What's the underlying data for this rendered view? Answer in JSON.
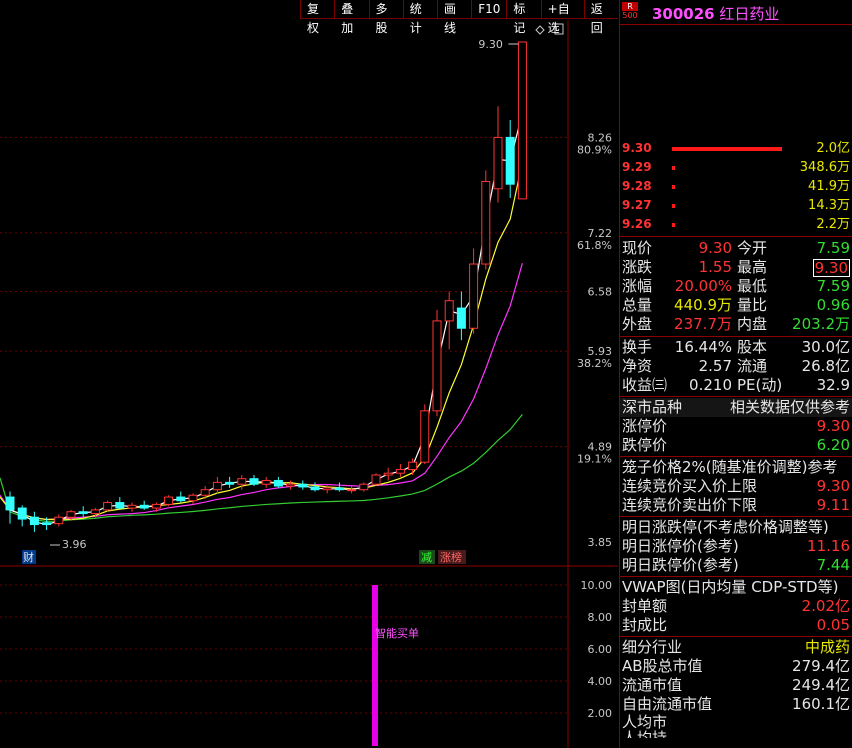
{
  "toolbar": [
    "复权",
    "叠加",
    "多股",
    "统计",
    "画线",
    "F10",
    "标记",
    "+自选",
    "返回"
  ],
  "header": {
    "badge_r": "R",
    "badge_num": "500",
    "code": "300026",
    "name": "红日药业"
  },
  "order_book": [
    {
      "price": "9.30",
      "vol": "2.0亿",
      "frac": 1.0
    },
    {
      "price": "9.29",
      "vol": "348.6万",
      "frac": 0.02
    },
    {
      "price": "9.28",
      "vol": "41.9万",
      "frac": 0.01
    },
    {
      "price": "9.27",
      "vol": "14.3万",
      "frac": 0.01
    },
    {
      "price": "9.26",
      "vol": "2.2万",
      "frac": 0.01
    }
  ],
  "quote": [
    {
      "l1": "现价",
      "v1": "9.30",
      "c1": "red",
      "l2": "今开",
      "v2": "7.59",
      "c2": "grn"
    },
    {
      "l1": "涨跌",
      "v1": "1.55",
      "c1": "red",
      "l2": "最高",
      "v2": "9.30",
      "c2": "red",
      "boxed": true
    },
    {
      "l1": "涨幅",
      "v1": "20.00%",
      "c1": "red",
      "l2": "最低",
      "v2": "7.59",
      "c2": "grn"
    },
    {
      "l1": "总量",
      "v1": "440.9万",
      "c1": "yel",
      "l2": "量比",
      "v2": "0.96",
      "c2": "grn"
    },
    {
      "l1": "外盘",
      "v1": "237.7万",
      "c1": "red",
      "l2": "内盘",
      "v2": "203.2万",
      "c2": "grn"
    }
  ],
  "fund": [
    {
      "l1": "换手",
      "v1": "16.44%",
      "l2": "股本",
      "v2": "30.0亿"
    },
    {
      "l1": "净资",
      "v1": "2.57",
      "l2": "流通",
      "v2": "26.8亿"
    },
    {
      "l1": "收益㈢",
      "v1": "0.210",
      "l2": "PE(动)",
      "v2": "32.9"
    }
  ],
  "limits": {
    "board": "深市品种",
    "note": "相关数据仅供参考",
    "up_label": "涨停价",
    "up": "9.30",
    "down_label": "跌停价",
    "down": "6.20"
  },
  "cage": {
    "title": "笼子价格2%(随基准价调整)参考",
    "buy_label": "连续竞价买入价上限",
    "buy": "9.30",
    "sell_label": "连续竞价卖出价下限",
    "sell": "9.11"
  },
  "tomorrow": {
    "title": "明日涨跌停(不考虑价格调整等)",
    "up_label": "明日涨停价(参考)",
    "up": "11.16",
    "down_label": "明日跌停价(参考)",
    "down": "7.44"
  },
  "vwap": {
    "title": "VWAP图(日内均量 CDP-STD等)",
    "seal_label": "封单额",
    "seal": "2.02亿",
    "ratio_label": "封成比",
    "ratio": "0.05"
  },
  "industry": {
    "label": "细分行业",
    "value": "中成药",
    "ab_label": "AB股总市值",
    "ab": "279.4亿",
    "float_label": "流通市值",
    "float": "249.4亿",
    "free_label": "自由流通市值",
    "free": "160.1亿",
    "per1": "人均市",
    "per2": "人均持"
  },
  "chart_text": {
    "high_label": "9.30",
    "low_label": "3.96",
    "cai": "财",
    "jian": "减",
    "zhang": "涨榜",
    "indicator_label": "智能买单",
    "price_ticks": [
      "8.26",
      "7.22",
      "6.58",
      "5.93",
      "4.89",
      "3.85"
    ],
    "pct_ticks": [
      "80.9%",
      "61.8%",
      "38.2%",
      "19.1%"
    ],
    "ind_ticks": [
      "10.00",
      "8.00",
      "6.00",
      "4.00",
      "2.00"
    ]
  },
  "chart_data": {
    "type": "candlestick",
    "ylim": [
      3.85,
      9.3
    ],
    "candles": [
      [
        4.34,
        4.4,
        4.05,
        4.2
      ],
      [
        4.22,
        4.25,
        4.02,
        4.1
      ],
      [
        4.12,
        4.18,
        3.96,
        4.04
      ],
      [
        4.06,
        4.12,
        3.98,
        4.04
      ],
      [
        4.05,
        4.15,
        4.02,
        4.12
      ],
      [
        4.12,
        4.2,
        4.08,
        4.18
      ],
      [
        4.18,
        4.24,
        4.12,
        4.16
      ],
      [
        4.16,
        4.22,
        4.1,
        4.2
      ],
      [
        4.2,
        4.3,
        4.18,
        4.28
      ],
      [
        4.28,
        4.34,
        4.2,
        4.22
      ],
      [
        4.22,
        4.28,
        4.18,
        4.25
      ],
      [
        4.25,
        4.3,
        4.2,
        4.22
      ],
      [
        4.22,
        4.28,
        4.18,
        4.26
      ],
      [
        4.26,
        4.36,
        4.24,
        4.34
      ],
      [
        4.34,
        4.4,
        4.28,
        4.3
      ],
      [
        4.3,
        4.38,
        4.26,
        4.36
      ],
      [
        4.36,
        4.46,
        4.32,
        4.42
      ],
      [
        4.42,
        4.56,
        4.38,
        4.5
      ],
      [
        4.5,
        4.56,
        4.44,
        4.48
      ],
      [
        4.48,
        4.58,
        4.42,
        4.54
      ],
      [
        4.54,
        4.58,
        4.46,
        4.48
      ],
      [
        4.48,
        4.56,
        4.44,
        4.52
      ],
      [
        4.52,
        4.56,
        4.44,
        4.46
      ],
      [
        4.46,
        4.52,
        4.42,
        4.48
      ],
      [
        4.48,
        4.52,
        4.42,
        4.45
      ],
      [
        4.45,
        4.5,
        4.4,
        4.42
      ],
      [
        4.42,
        4.48,
        4.38,
        4.44
      ],
      [
        4.44,
        4.5,
        4.4,
        4.42
      ],
      [
        4.42,
        4.46,
        4.38,
        4.42
      ],
      [
        4.42,
        4.5,
        4.4,
        4.48
      ],
      [
        4.48,
        4.6,
        4.46,
        4.58
      ],
      [
        4.58,
        4.66,
        4.52,
        4.6
      ],
      [
        4.6,
        4.7,
        4.56,
        4.64
      ],
      [
        4.64,
        4.76,
        4.58,
        4.72
      ],
      [
        4.72,
        5.35,
        4.7,
        5.28
      ],
      [
        5.28,
        6.38,
        5.22,
        6.26
      ],
      [
        6.26,
        6.58,
        5.95,
        6.48
      ],
      [
        6.4,
        6.58,
        6.05,
        6.18
      ],
      [
        6.18,
        7.05,
        6.12,
        6.88
      ],
      [
        6.88,
        7.9,
        6.82,
        7.78
      ],
      [
        7.7,
        8.6,
        7.55,
        8.26
      ],
      [
        8.26,
        8.45,
        7.6,
        7.75
      ],
      [
        7.59,
        9.3,
        7.59,
        9.3
      ]
    ],
    "indicator": {
      "name": "智能买单",
      "values": [
        10.0
      ],
      "ylim": [
        0,
        10
      ]
    }
  }
}
